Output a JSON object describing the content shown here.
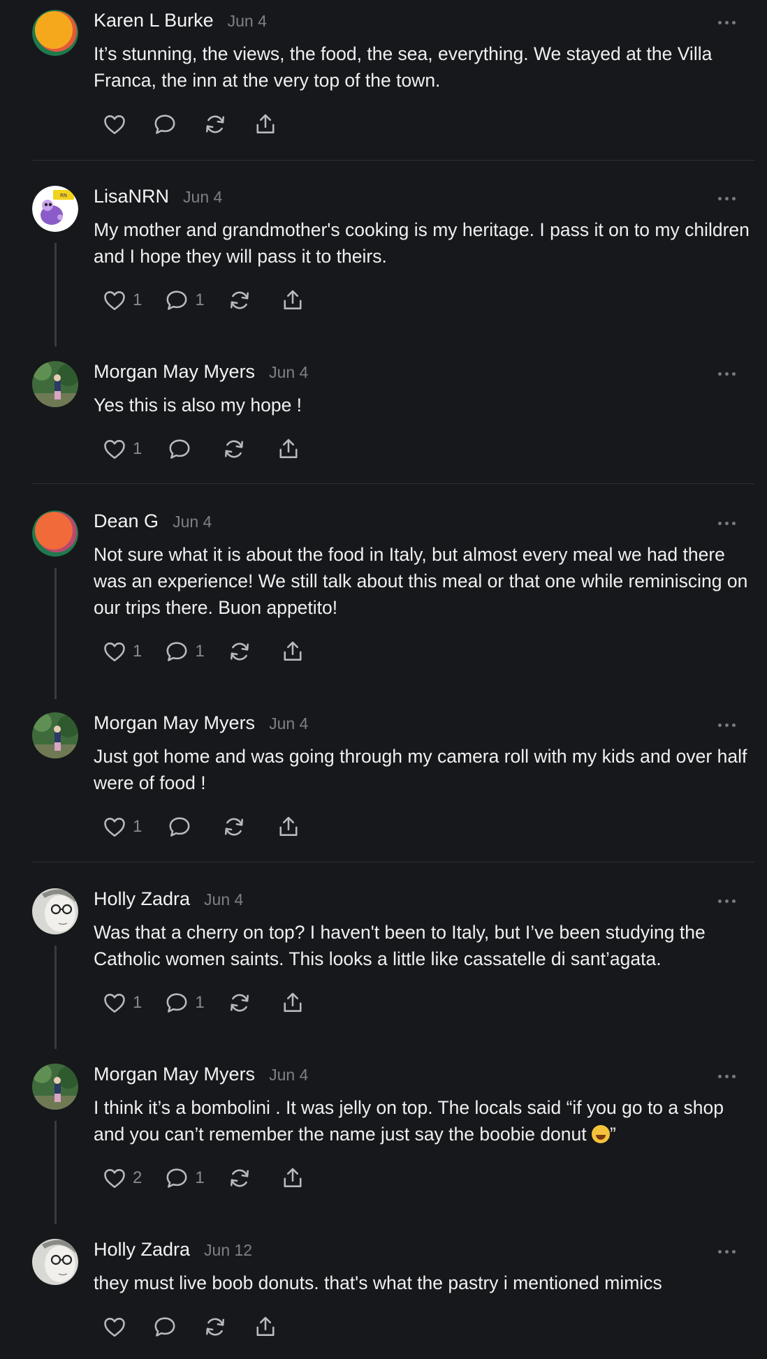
{
  "posts": [
    {
      "author": "Karen L Burke",
      "date": "Jun 4",
      "text": "It’s stunning, the views, the food, the sea, everything. We stayed at the Villa Franca, the inn at the very top of the town.",
      "likes": "",
      "replies": "",
      "avatar": "orange-circle-avatar"
    },
    {
      "author": "LisaNRN",
      "date": "Jun 4",
      "text": "My mother and grandmother's cooking is my heritage. I pass it on to my children and I hope they will pass it to theirs.",
      "likes": "1",
      "replies": "1",
      "avatar": "cartoon-avatar"
    },
    {
      "author": "Morgan May Myers",
      "date": "Jun 4",
      "text": "Yes this is also my hope !",
      "likes": "1",
      "replies": "",
      "avatar": "garden-photo-avatar"
    },
    {
      "author": "Dean G",
      "date": "Jun 4",
      "text": "Not sure what it is about the food in Italy, but almost every meal we had there was an experience! We still talk about this meal or that one while reminiscing on our trips there. Buon appetito!",
      "likes": "1",
      "replies": "1",
      "avatar": "orange-circle-avatar"
    },
    {
      "author": "Morgan May Myers",
      "date": "Jun 4",
      "text": "Just got home and was going through my camera roll with my kids and over half were of food !",
      "likes": "1",
      "replies": "",
      "avatar": "garden-photo-avatar"
    },
    {
      "author": "Holly Zadra",
      "date": "Jun 4",
      "text": "Was that a cherry on top? I haven't been to Italy, but I’ve been studying the Catholic women saints. This looks a little like cassatelle di sant’agata.",
      "likes": "1",
      "replies": "1",
      "avatar": "sketch-portrait-avatar"
    },
    {
      "author": "Morgan May Myers",
      "date": "Jun 4",
      "text": "I think it’s a bombolini . It was jelly on top. The locals said “if you go to a shop and you can’t remember the name just say the boobie donut",
      "text_end": "”",
      "emoji": "laughing-emoji",
      "likes": "2",
      "replies": "1",
      "avatar": "garden-photo-avatar"
    },
    {
      "author": "Holly Zadra",
      "date": "Jun 12",
      "text": "they must live boob donuts. that's what the pastry i mentioned mimics",
      "likes": "",
      "replies": "",
      "avatar": "sketch-portrait-avatar"
    }
  ],
  "icons": {
    "like": "heart-icon",
    "reply": "comment-icon",
    "repost": "repost-icon",
    "share": "share-icon",
    "more": "more-options-icon"
  },
  "colors": {
    "background": "#17181b",
    "text": "#f2f2f2",
    "muted": "#7f8084",
    "divider": "#2e2f33"
  }
}
